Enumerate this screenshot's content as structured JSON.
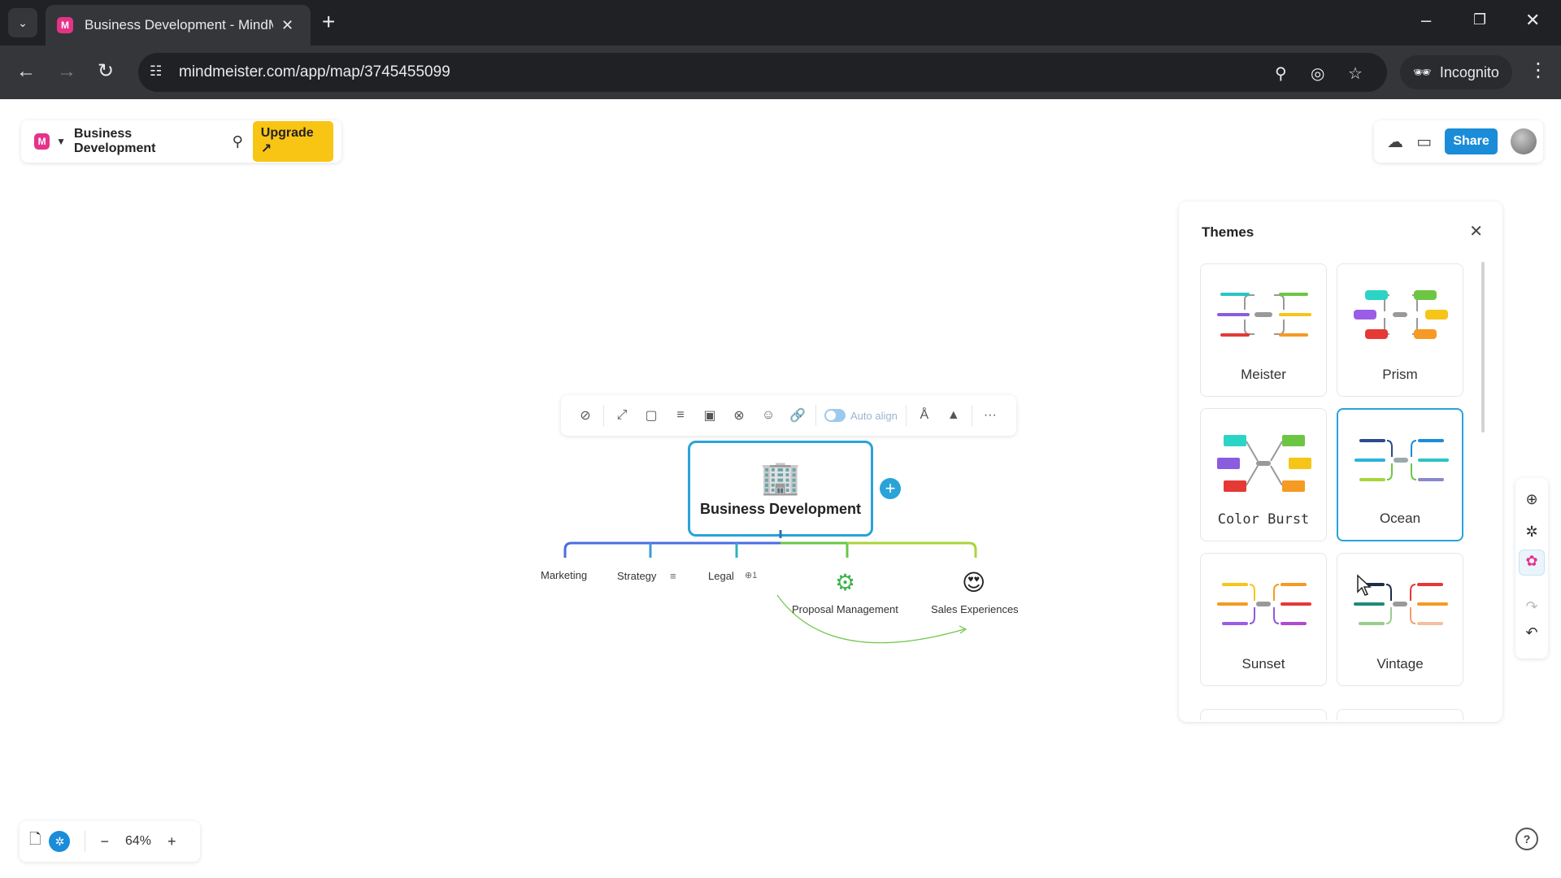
{
  "browser": {
    "tab_title": "Business Development - MindM",
    "favicon_letter": "M",
    "url": "mindmeister.com/app/map/3745455099",
    "incognito_label": "Incognito"
  },
  "app": {
    "logo_letter": "M",
    "map_title": "Business Development",
    "upgrade_label": "Upgrade ↗",
    "share_label": "Share"
  },
  "toolbar": {
    "auto_align_label": "Auto align"
  },
  "mindmap": {
    "central_title": "Business Development",
    "central_icon": "building-icon",
    "branch_colors": [
      "#4a6ee0",
      "#3a9bd9",
      "#2bb3c0",
      "#6cc644",
      "#a8d43c"
    ],
    "children": [
      {
        "label": "Marketing"
      },
      {
        "label": "Strategy",
        "badge": "≡"
      },
      {
        "label": "Legal",
        "badge": "⊕1"
      },
      {
        "label": "Proposal Management",
        "icon": "gear-person-icon"
      },
      {
        "label": "Sales Experiences",
        "icon": "heart-eyes-emoji-icon"
      }
    ]
  },
  "themes_panel": {
    "title": "Themes",
    "themes": [
      {
        "name": "Meister",
        "selected": false
      },
      {
        "name": "Prism",
        "selected": false
      },
      {
        "name": "Color Burst",
        "selected": false
      },
      {
        "name": "Ocean",
        "selected": true
      },
      {
        "name": "Sunset",
        "selected": false
      },
      {
        "name": "Vintage",
        "selected": false
      }
    ]
  },
  "zoom": {
    "level": "64%"
  },
  "colors": {
    "accent": "#1b8cd8",
    "node_border": "#29a3d8",
    "upgrade": "#f9c514",
    "brand": "#e43388"
  }
}
